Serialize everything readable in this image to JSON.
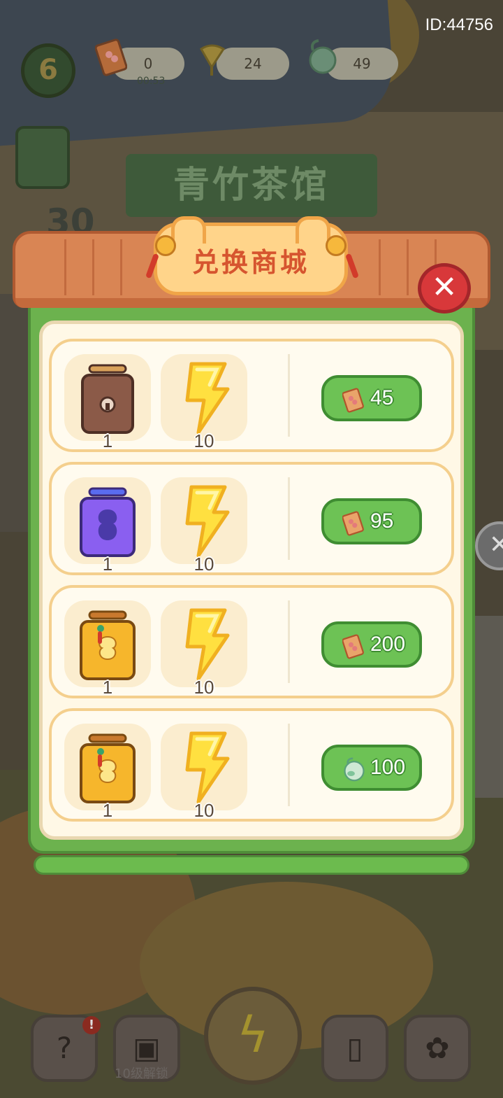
{
  "hud": {
    "id_label": "ID:44756",
    "level": "6",
    "tickets": "0",
    "timer": "00:53",
    "ginkgo": "24",
    "jade": "49",
    "side_number": "30"
  },
  "background": {
    "sign_text": "青竹茶馆"
  },
  "bottom_nav": {
    "help_glyph": "?",
    "badge": "!",
    "unlock_label": "10级解锁"
  },
  "modal": {
    "title": "兑换商城",
    "close_glyph": "✕",
    "rows": [
      {
        "box_type": "brown-chest",
        "box_count": "1",
        "energy_count": "10",
        "currency": "ticket",
        "price": "45"
      },
      {
        "box_type": "purple-chest",
        "box_count": "1",
        "energy_count": "10",
        "currency": "ticket",
        "price": "95"
      },
      {
        "box_type": "golden-chest",
        "box_count": "1",
        "energy_count": "10",
        "currency": "ticket",
        "price": "200"
      },
      {
        "box_type": "golden-chest",
        "box_count": "1",
        "energy_count": "10",
        "currency": "jade",
        "price": "100"
      }
    ]
  },
  "colors": {
    "modal_green": "#6cb24e",
    "roof_orange": "#d98554",
    "title_red": "#d6552f",
    "buy_green": "#6dc255",
    "close_red": "#d8383a",
    "row_border": "#f4cf8d"
  }
}
